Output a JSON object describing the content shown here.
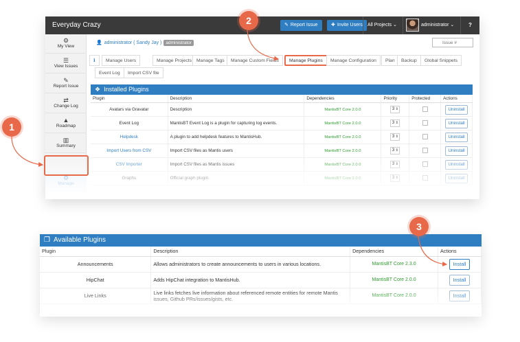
{
  "app": {
    "brand": "Everyday Crazy",
    "report_issue": "Report Issue",
    "invite_users": "Invite Users",
    "projects": "All Projects",
    "username": "administrator",
    "help": "?"
  },
  "sidebar": {
    "items": [
      {
        "label": "My View",
        "icon": "dashboard-icon",
        "glyph": "⚙"
      },
      {
        "label": "View Issues",
        "icon": "list-icon",
        "glyph": "☰"
      },
      {
        "label": "Report Issue",
        "icon": "edit-icon",
        "glyph": "✎"
      },
      {
        "label": "Change Log",
        "icon": "retweet-icon",
        "glyph": "⇄"
      },
      {
        "label": "Roadmap",
        "icon": "road-icon",
        "glyph": "▲"
      },
      {
        "label": "Summary",
        "icon": "bar-chart-icon",
        "glyph": "▥"
      },
      {
        "label": "Manage",
        "icon": "gears-icon",
        "glyph": "⚙"
      },
      {
        "label": "Time Tracking",
        "icon": "clock-icon",
        "glyph": "◷"
      }
    ]
  },
  "crumb": {
    "user": "administrator ( Sandy Jay )",
    "role": "administrator"
  },
  "search": {
    "placeholder": "Issue #"
  },
  "tabs": {
    "info": "ℹ",
    "items": [
      "Manage Users",
      "Manage Projects",
      "Manage Tags",
      "Manage Custom Fields",
      "Manage Plugins",
      "Manage Configuration",
      "Plan",
      "Backup",
      "Global Snippets",
      "Event Log",
      "Import CSV file"
    ],
    "active": "Manage Plugins"
  },
  "installed": {
    "title": "Installed Plugins",
    "headers": [
      "Plugin",
      "Description",
      "Dependencies",
      "Priority",
      "Protected",
      "Actions"
    ],
    "rows": [
      {
        "plugin": "Avatars via Gravatar",
        "description": "Description",
        "dependencies": "MantisBT Core 2.0.0",
        "priority": "3",
        "action": "Uninstall"
      },
      {
        "plugin": "Event Log",
        "description": "MantisBT Event Log is a plugin for capturing log events.",
        "dependencies": "MantisBT Core 2.0.0",
        "priority": "3",
        "action": "Uninstall"
      },
      {
        "plugin": "Helpdesk",
        "description": "A plugin to add helpdesk features to MantisHub.",
        "dependencies": "MantisBT Core 2.0.0",
        "priority": "3",
        "action": "Uninstall"
      },
      {
        "plugin": "Import Users from CSV",
        "description": "Import CSV files as Mantis users",
        "dependencies": "MantisBT Core 2.0.0",
        "priority": "3",
        "action": "Uninstall"
      },
      {
        "plugin": "CSV Importer",
        "description": "Import CSV files as Mantis issues",
        "dependencies": "MantisBT Core 2.0.0",
        "priority": "3",
        "action": "Uninstall"
      },
      {
        "plugin": "Graphs",
        "description": "Official graph plugin.",
        "dependencies": "MantisBT Core 2.0.0",
        "priority": "3",
        "action": "Uninstall"
      }
    ]
  },
  "available": {
    "title": "Available Plugins",
    "headers": [
      "Plugin",
      "Description",
      "Dependencies",
      "Actions"
    ],
    "rows": [
      {
        "plugin": "Announcements",
        "description": "Allows administrators to create announcements to users in various locations.",
        "dependencies": "MantisBT Core 2.3.0",
        "action": "Install"
      },
      {
        "plugin": "HipChat",
        "description": "Adds HipChat integration to MantisHub.",
        "dependencies": "MantisBT Core 2.0.0",
        "action": "Install"
      },
      {
        "plugin": "Live Links",
        "description": "Live links fetches live information about referenced remote entities for remote Mantis issues, Github PRs/issues/gists, etc.",
        "dependencies": "MantisBT Core 2.0.0",
        "action": "Install"
      }
    ]
  },
  "callouts": [
    "1",
    "2",
    "3"
  ],
  "colors": {
    "accent": "#2f7ec1",
    "callout": "#e8694a",
    "topbar": "#3a3a3a",
    "dependency": "#2e9b2e"
  }
}
